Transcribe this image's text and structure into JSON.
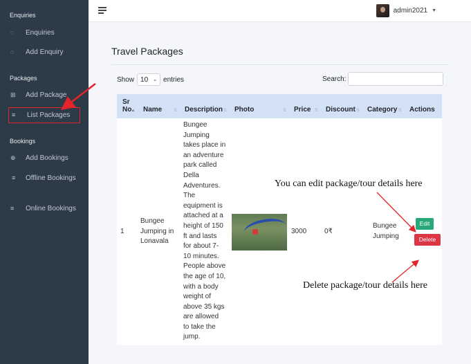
{
  "sidebar": {
    "sections": [
      {
        "heading": "Enquiries",
        "items": [
          {
            "label": "Enquiries",
            "icon": "chat-icon"
          },
          {
            "label": "Add Enquiry",
            "icon": "chat-icon"
          }
        ]
      },
      {
        "heading": "Packages",
        "items": [
          {
            "label": "Add Package",
            "icon": "plus-square-icon"
          },
          {
            "label": "List Packages",
            "icon": "list-icon"
          }
        ]
      },
      {
        "heading": "Bookings",
        "items": [
          {
            "label": "Add Bookings",
            "icon": "plus-circle-icon"
          },
          {
            "label": "Offline Bookings",
            "icon": "list-icon"
          },
          {
            "label": "Online Bookings",
            "icon": "list-icon"
          }
        ]
      }
    ]
  },
  "topbar": {
    "username": "admin2021"
  },
  "page": {
    "title": "Travel Packages"
  },
  "table_controls": {
    "show_label": "Show",
    "entries_value": "10",
    "entries_label": "entries",
    "search_label": "Search:"
  },
  "table": {
    "headers": [
      "Sr No.",
      "Name",
      "Description",
      "Photo",
      "Price",
      "Discount",
      "Category",
      "Actions"
    ],
    "rows": [
      {
        "sr": "1",
        "name": "Bungee Jumping in Lonavala",
        "description": "Bungee Jumping takes place in an adventure park called Della Adventures. The equipment is attached at a height of 150 ft and lasts for about 7-10 minutes. People above the age of 10, with a body weight of above 35 kgs are allowed to take the jump.",
        "price": "3000",
        "discount": "0₹",
        "category": "Bungee Jumping",
        "edit_label": "Edit",
        "delete_label": "Delete"
      }
    ]
  },
  "annotations": {
    "edit_note": "You can edit package/tour details here",
    "delete_note": "Delete package/tour details here"
  },
  "colors": {
    "sidebar_bg": "#2c3b47",
    "header_bg": "#d3e1f7",
    "edit_btn": "#28a878",
    "delete_btn": "#dc3545",
    "annotation_arrow": "#e3242b"
  }
}
